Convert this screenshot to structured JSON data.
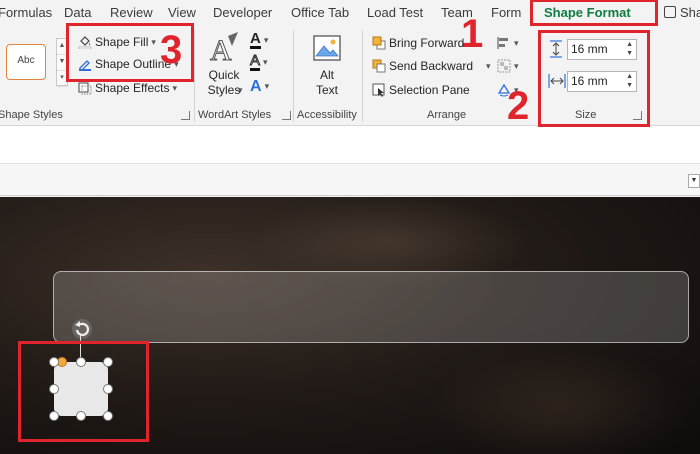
{
  "tabs": [
    "Formulas",
    "Data",
    "Review",
    "View",
    "Developer",
    "Office Tab",
    "Load Test",
    "Team",
    "Form",
    "Shape Format"
  ],
  "active_tab": "Shape Format",
  "share_label": "Share",
  "ribbon": {
    "shape_styles": {
      "sample": "Abc",
      "shape_fill": "Shape Fill",
      "shape_outline": "Shape Outline",
      "shape_effects": "Shape Effects",
      "group_label": "Shape Styles"
    },
    "wordart": {
      "quick_styles_line1": "Quick",
      "quick_styles_line2": "Styles",
      "text_a": "A",
      "group_label": "WordArt Styles"
    },
    "accessibility": {
      "alt_text_line1": "Alt",
      "alt_text_line2": "Text",
      "group_label": "Accessibility"
    },
    "arrange": {
      "bring_forward": "Bring Forward",
      "send_backward": "Send Backward",
      "selection_pane": "Selection Pane",
      "group_label": "Arrange"
    },
    "size": {
      "height_value": "16 mm",
      "width_value": "16 mm",
      "group_label": "Size"
    }
  },
  "annotations": {
    "one": "1",
    "two": "2",
    "three": "3",
    "color": "#e0242d"
  },
  "colors": {
    "active_tab": "#107c41",
    "accent_orange": "#e0843f",
    "wordart_blue": "#2f6fd6"
  }
}
